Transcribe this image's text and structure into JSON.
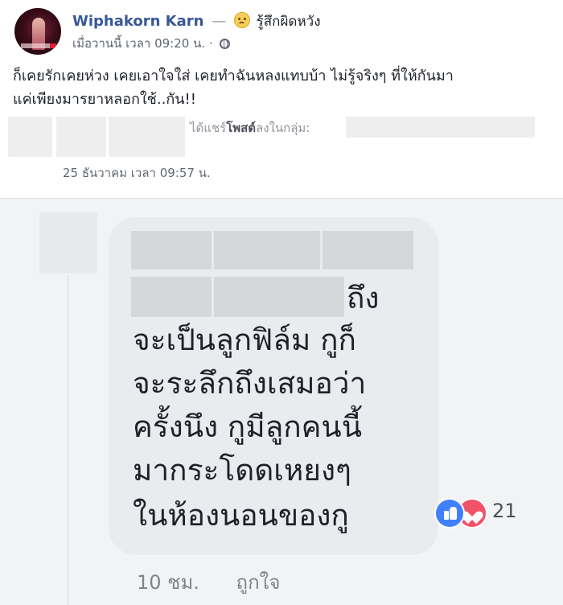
{
  "post": {
    "author": "Wiphakorn Karn",
    "separator": "—",
    "feeling_icon": "sad-face-emoji",
    "feeling": "รู้สึกผิดหวัง",
    "timestamp": "เมื่อวานนี้ เวลา 09:20 น. ·",
    "privacy_icon": "globe-icon",
    "text_line1": "ก็เคยรักเคยห่วง เคยเอาใจใส่ เคยทำฉันหลงแทบบ้า ไม่รู้จริงๆ ที่ให้กันมา",
    "text_line2": "แค่เพียงมารยาหลอกใช้..กัน!!",
    "shared_prefix": "ได้แชร์",
    "shared_link": "โพสต์",
    "shared_suffix": "ลงในกลุ่ม:",
    "shared_date": "25 ธันวาคม เวลา 09:57 น."
  },
  "comment": {
    "line_partial": "ถึง",
    "lines": [
      "จะเป็นลูกฟิล์ม กูก็",
      "จะระลึกถึงเสมอว่า",
      "ครั้งนึง กูมีลูกคนนี้",
      "มากระโดดเหยงๆ",
      "ในห้องนอนของกู"
    ],
    "reaction_icons": [
      "like-icon",
      "love-icon"
    ],
    "reaction_count": "21",
    "time": "10 ชม.",
    "like_label": "ถูกใจ"
  },
  "colors": {
    "name_blue": "#385898",
    "comment_bg": "#f2f3f5",
    "bubble_bg": "#e9ebee",
    "like_blue": "#4080ff",
    "love_red": "#f25268"
  }
}
